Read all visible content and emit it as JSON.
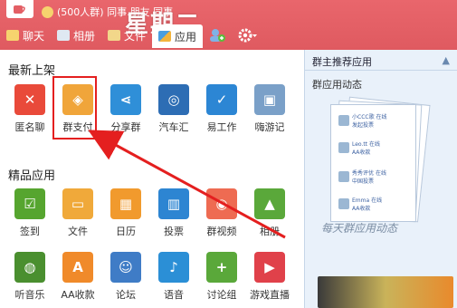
{
  "header": {
    "group_text": "(500人群) 同事.朋友.同事",
    "overlay_text": "星期二"
  },
  "tabs": [
    {
      "label": "聊天"
    },
    {
      "label": "相册"
    },
    {
      "label": "文件"
    },
    {
      "label": "应用"
    }
  ],
  "sections": {
    "new_apps_title": "最新上架",
    "featured_title": "精品应用"
  },
  "new_apps": [
    {
      "label": "匿名聊",
      "color": "#e94a3a",
      "icon": "anonymous-chat-icon"
    },
    {
      "label": "群支付",
      "color": "#f0a53a",
      "icon": "group-pay-icon"
    },
    {
      "label": "分享群",
      "color": "#2f8fd8",
      "icon": "share-icon"
    },
    {
      "label": "汽车汇",
      "color": "#2d6db4",
      "icon": "car-icon"
    },
    {
      "label": "易工作",
      "color": "#2c86d4",
      "icon": "work-icon"
    },
    {
      "label": "嗨游记",
      "color": "#7aa0c8",
      "icon": "travel-icon"
    }
  ],
  "featured_row1": [
    {
      "label": "签到",
      "color": "#56a52f",
      "icon": "checkin-icon"
    },
    {
      "label": "文件",
      "color": "#f0a93a",
      "icon": "folder-icon"
    },
    {
      "label": "日历",
      "color": "#f19a2d",
      "icon": "calendar-icon"
    },
    {
      "label": "投票",
      "color": "#2d85d2",
      "icon": "vote-icon"
    },
    {
      "label": "群视频",
      "color": "#ee6b52",
      "icon": "video-icon"
    },
    {
      "label": "相册",
      "color": "#5aa83a",
      "icon": "photo-icon"
    }
  ],
  "featured_row2": [
    {
      "label": "听音乐",
      "color": "#4a8f2f",
      "icon": "music-icon"
    },
    {
      "label": "AA收款",
      "color": "#f08a2a",
      "icon": "aa-icon"
    },
    {
      "label": "论坛",
      "color": "#3f7cc6",
      "icon": "forum-icon"
    },
    {
      "label": "语音",
      "color": "#2b8fd6",
      "icon": "voice-icon"
    },
    {
      "label": "讨论组",
      "color": "#5aa83a",
      "icon": "discussion-icon"
    },
    {
      "label": "游戏直播",
      "color": "#e0414a",
      "icon": "game-live-icon"
    }
  ],
  "right_panel": {
    "title": "群主推荐应用",
    "subtitle": "群应用动态",
    "caption": "每天群应用动态",
    "entries": [
      {
        "name": "小CCC歌",
        "status": "在线",
        "action": "发起投票"
      },
      {
        "name": "Leo.tt",
        "status": "在线",
        "action": "AA收款"
      },
      {
        "name": "秀秀评优",
        "status": "在线",
        "action": "中国投票"
      },
      {
        "name": "Emma",
        "status": "在线",
        "action": "AA收款"
      }
    ]
  },
  "colors": {
    "header": "#e35f65",
    "highlight": "#e41f1f",
    "arrow": "#e41f1f",
    "right_bg": "#e9f1fa"
  }
}
